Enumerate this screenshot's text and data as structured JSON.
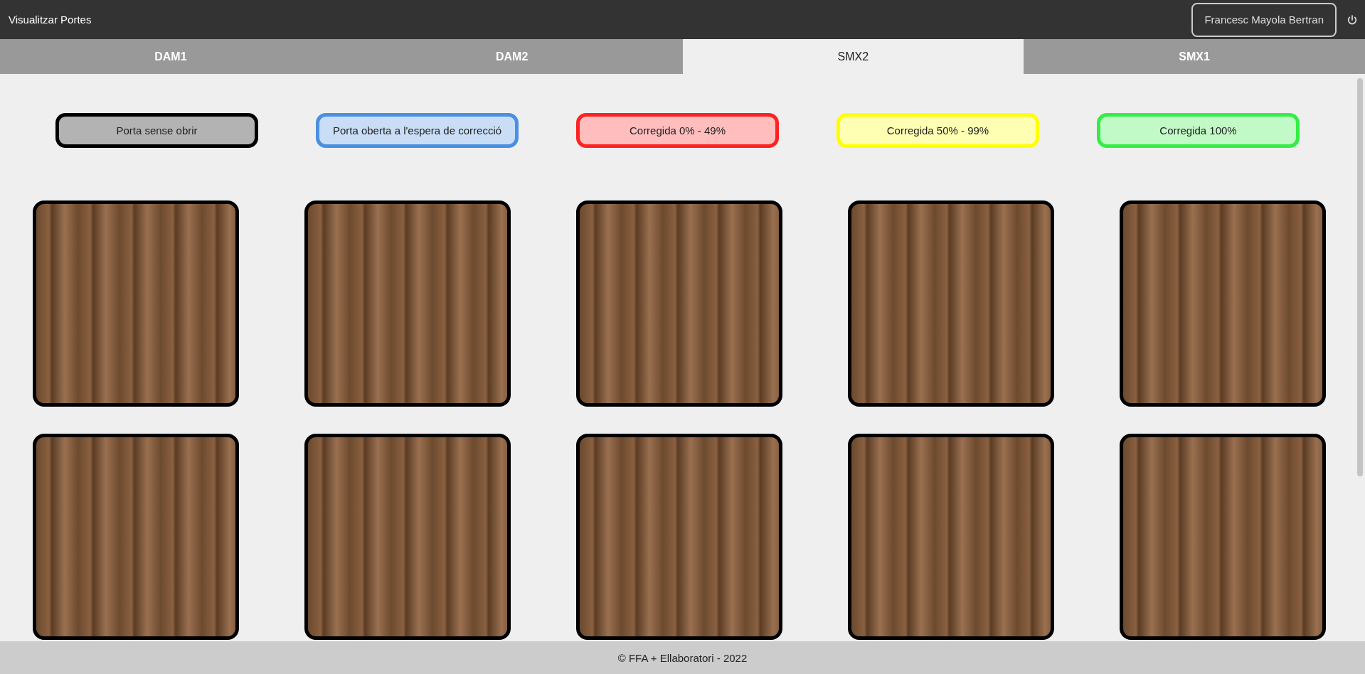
{
  "header": {
    "title": "Visualitzar Portes",
    "user": "Francesc Mayola Bertran"
  },
  "tabs": [
    {
      "label": "DAM1",
      "selected": false
    },
    {
      "label": "DAM2",
      "selected": false
    },
    {
      "label": "SMX2",
      "selected": true
    },
    {
      "label": "SMX1",
      "selected": false
    }
  ],
  "legend": [
    {
      "label": "Porta sense obrir",
      "color": "#000000"
    },
    {
      "label": "Porta oberta a l'espera de correcció",
      "color": "#4a90e2"
    },
    {
      "label": "Corregida 0% - 49%",
      "color": "#ff2222"
    },
    {
      "label": "Corregida 50% - 99%",
      "color": "#ffff00"
    },
    {
      "label": "Corregida 100%",
      "color": "#33ee44"
    }
  ],
  "doors": [
    {
      "color": "#000000"
    },
    {
      "color": "#000000"
    },
    {
      "color": "#000000"
    },
    {
      "color": "#000000"
    },
    {
      "color": "#000000"
    },
    {
      "color": "#000000"
    },
    {
      "color": "#000000"
    },
    {
      "color": "#000000"
    },
    {
      "color": "#000000"
    },
    {
      "color": "#000000"
    }
  ],
  "footer": "© FFA + Ellaboratori - 2022"
}
